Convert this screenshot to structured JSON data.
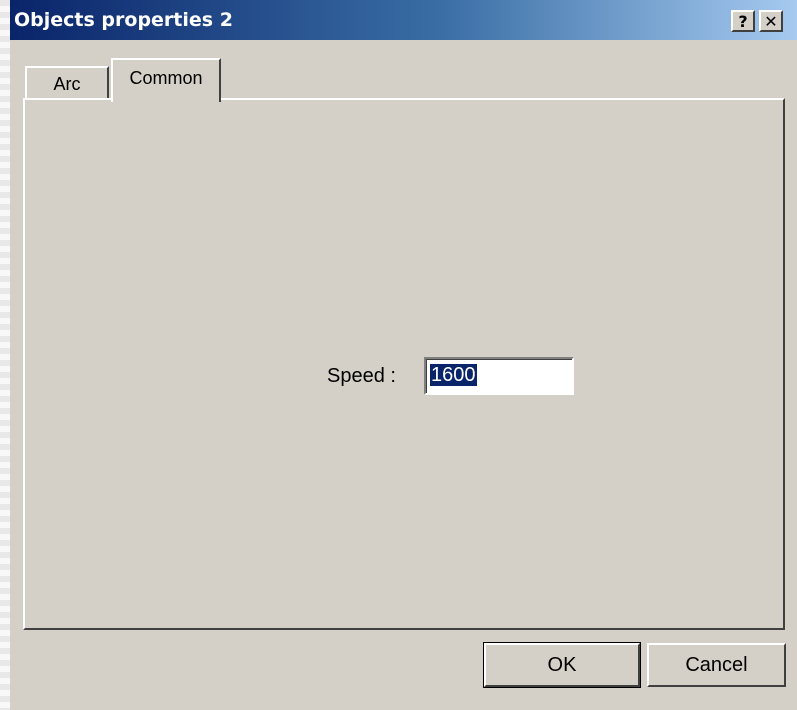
{
  "window": {
    "title": "Objects properties 2",
    "help_label": "?",
    "close_label": "✕"
  },
  "tabs": [
    {
      "label": "Arc",
      "active": false
    },
    {
      "label": "Common",
      "active": true
    }
  ],
  "common": {
    "speed_label": "Speed :",
    "speed_value": "1600"
  },
  "buttons": {
    "ok_label": "OK",
    "cancel_label": "Cancel"
  },
  "colors": {
    "title_start": "#0a246a",
    "title_end": "#a6caf0",
    "face": "#d4d0c8",
    "selection": "#0a246a"
  }
}
